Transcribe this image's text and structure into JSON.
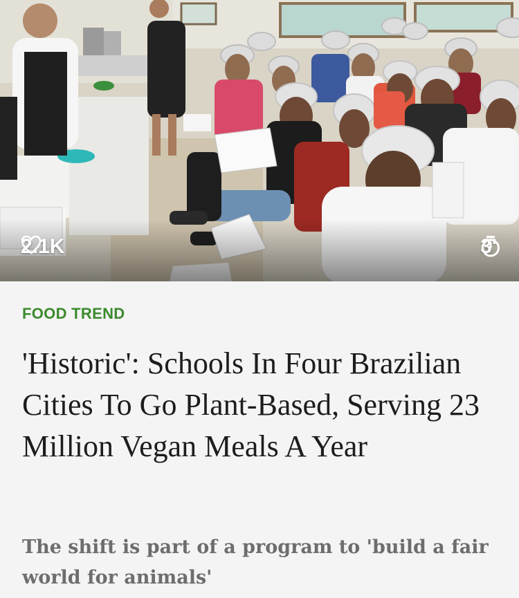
{
  "hero": {
    "image": "cooking-class-photo",
    "likes_count": "2.1K",
    "likes_icon": "heart-outline-icon",
    "read_time": "3'",
    "read_time_icon": "stopwatch-icon"
  },
  "article": {
    "category": "FOOD TREND",
    "headline": "'Historic': Schools In Four Brazilian Cities To Go Plant-Based, Serving 23 Million Vegan Meals A Year",
    "subhead": "The shift is part of a program to 'build a fair world for animals'"
  },
  "colors": {
    "category": "#3b8a2c",
    "headline": "#1d1d1d",
    "subhead": "#6d6d6d",
    "background": "#f4f4f4"
  }
}
